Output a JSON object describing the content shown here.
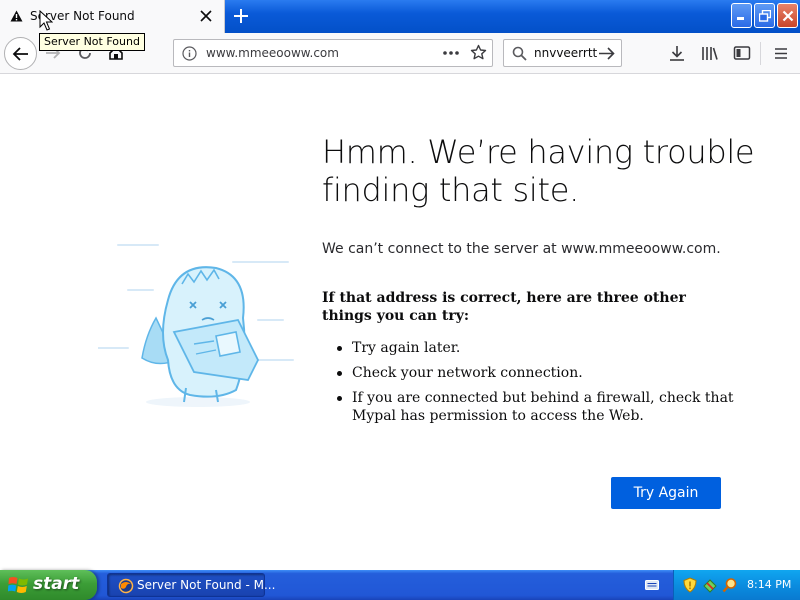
{
  "browser": {
    "tab": {
      "title": "Server Not Found",
      "tooltip": "Server Not Found"
    },
    "url": "www.mmeeooww.com",
    "search_text": "nnvveerrtt"
  },
  "error_page": {
    "title": "Hmm. We’re having trouble finding that site.",
    "description": "We can’t connect to the server at www.mmeeooww.com.",
    "suggestions_heading": "If that address is correct, here are three other things you can try:",
    "suggestions": [
      "Try again later.",
      "Check your network connection.",
      "If you are connected but behind a firewall, check that Mypal has permission to access the Web."
    ],
    "try_again_label": "Try Again"
  },
  "taskbar": {
    "start_label": "start",
    "task_item_label": "Server Not Found - M...",
    "clock": "8:14 PM"
  },
  "colors": {
    "accent": "#0060df",
    "titlebar": "#0a5ad8",
    "start": "#3c9e37",
    "tray": "#0b8de0"
  },
  "icons": {
    "tab": "warning-icon",
    "navigation": [
      "back-arrow-icon",
      "forward-arrow-icon",
      "reload-icon",
      "home-icon"
    ],
    "urlbar": [
      "info-icon",
      "page-actions-icon",
      "bookmark-star-icon"
    ],
    "toolbar": [
      "download-icon",
      "library-icon",
      "sidebar-icon",
      "hamburger-menu-icon"
    ],
    "tray": [
      "security-shield-icon",
      "network-icon",
      "search-icon"
    ]
  }
}
